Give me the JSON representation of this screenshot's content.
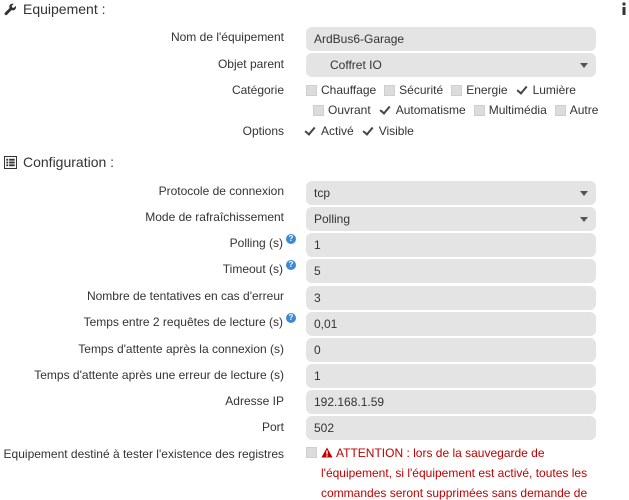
{
  "sections": {
    "equipement": "Equipement :",
    "configuration": "Configuration :"
  },
  "equipement": {
    "name_label": "Nom de l'équipement",
    "name_value": "ArdBus6-Garage",
    "parent_label": "Objet parent",
    "parent_value": "Coffret IO",
    "category_label": "Catégorie",
    "categories": [
      {
        "label": "Chauffage",
        "checked": false
      },
      {
        "label": "Sécurité",
        "checked": false
      },
      {
        "label": "Energie",
        "checked": false
      },
      {
        "label": "Lumière",
        "checked": true
      },
      {
        "label": "Ouvrant",
        "checked": false
      },
      {
        "label": "Automatisme",
        "checked": true
      },
      {
        "label": "Multimédia",
        "checked": false
      },
      {
        "label": "Autre",
        "checked": false
      }
    ],
    "options_label": "Options",
    "options": [
      {
        "label": "Activé",
        "checked": true
      },
      {
        "label": "Visible",
        "checked": true
      }
    ]
  },
  "config": {
    "protocol_label": "Protocole de connexion",
    "protocol_value": "tcp",
    "refresh_label": "Mode de rafraîchissement",
    "refresh_value": "Polling",
    "polling_label": "Polling (s)",
    "polling_value": "1",
    "timeout_label": "Timeout (s)",
    "timeout_value": "5",
    "retries_label": "Nombre de tentatives en cas d'erreur",
    "retries_value": "3",
    "between_label": "Temps entre 2 requêtes de lecture (s)",
    "between_value": "0,01",
    "after_conn_label": "Temps d'attente après la connexion (s)",
    "after_conn_value": "0",
    "after_err_label": "Temps d'attente après une erreur de lecture (s)",
    "after_err_value": "1",
    "ip_label": "Adresse IP",
    "ip_value": "192.168.1.59",
    "port_label": "Port",
    "port_value": "502",
    "test_label": "Equipement destiné à tester l'existence des registres",
    "test_checked": false,
    "warning": "ATTENTION : lors de la sauvegarde de l'équipement, si l'équipement est activé, toutes les commandes seront supprimées sans demande de confirmation",
    "help_glyph": "?"
  },
  "icons": {
    "wrench": "wrench-icon",
    "list": "list-icon",
    "warning": "warning-triangle-icon",
    "info": "info-icon",
    "dropdown": "caret-down-icon"
  },
  "colors": {
    "field_bg": "#e4e4e4",
    "help": "#3a8ad6",
    "warning": "#c00000"
  }
}
